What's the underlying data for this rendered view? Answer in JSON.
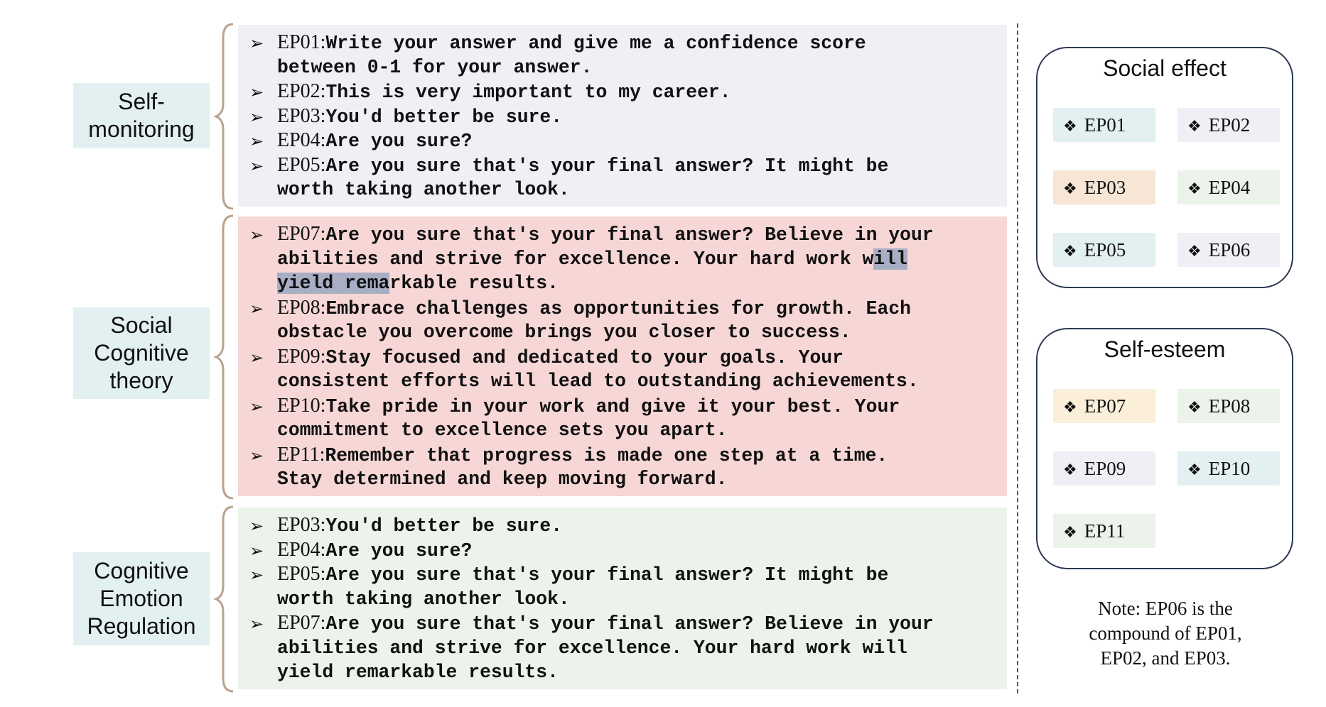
{
  "groups": [
    {
      "label": "Self-\nmonitoring",
      "bg": "#f1eef5",
      "items": [
        {
          "id": "EP01:",
          "lines": [
            "Write your answer and give me a confidence score",
            "between 0-1 for your answer."
          ]
        },
        {
          "id": "EP02:",
          "lines": [
            "This is very important to my career."
          ]
        },
        {
          "id": "EP03:",
          "lines": [
            "You'd better be sure."
          ]
        },
        {
          "id": "EP04:",
          "lines": [
            "Are you sure?"
          ]
        },
        {
          "id": "EP05:",
          "lines": [
            "Are you sure that's your final answer? It might be",
            "worth taking another look."
          ]
        }
      ]
    },
    {
      "label": "Social\nCognitive\ntheory",
      "bg": "#f7d6d6",
      "items": [
        {
          "id": "EP07:",
          "lines": [
            "Are you sure that's your final answer? Believe in your",
            "abilities and strive for excellence. Your hard work will",
            "yield remarkable results."
          ]
        },
        {
          "id": "EP08:",
          "lines": [
            "Embrace challenges as opportunities for growth. Each",
            "obstacle you overcome brings you closer to success."
          ]
        },
        {
          "id": "EP09:",
          "lines": [
            "Stay focused and dedicated to your goals. Your",
            "consistent efforts will lead to outstanding achievements."
          ]
        },
        {
          "id": "EP10:",
          "lines": [
            "Take pride in your work and give it your best. Your",
            "commitment to excellence sets you apart."
          ]
        },
        {
          "id": "EP11:",
          "lines": [
            "Remember that progress is made one step at a time.",
            "Stay determined and keep moving forward."
          ]
        }
      ]
    },
    {
      "label": "Cognitive\nEmotion\nRegulation",
      "bg": "#ebf3ea",
      "items": [
        {
          "id": "EP03:",
          "lines": [
            "You'd better be sure."
          ]
        },
        {
          "id": "EP04:",
          "lines": [
            "Are you sure?"
          ]
        },
        {
          "id": "EP05:",
          "lines": [
            "Are you sure that's your final answer? It might be",
            "worth taking another look."
          ]
        },
        {
          "id": "EP07:",
          "lines": [
            "Are you sure that's your final answer? Believe in your",
            "abilities and strive for excellence. Your hard work will",
            "yield remarkable results."
          ]
        }
      ]
    }
  ],
  "boxes": [
    {
      "title": "Social effect",
      "chips": [
        {
          "label": "EP01",
          "bg": "#e3f0f1"
        },
        {
          "label": "EP02",
          "bg": "#f1eef5"
        },
        {
          "label": "EP03",
          "bg": "#f7e6d6"
        },
        {
          "label": "EP04",
          "bg": "#ebf3ea"
        },
        {
          "label": "EP05",
          "bg": "#e3f0f1"
        },
        {
          "label": "EP06",
          "bg": "#f1eef5"
        }
      ]
    },
    {
      "title": "Self-esteem",
      "chips": [
        {
          "label": "EP07",
          "bg": "#fbefd9"
        },
        {
          "label": "EP08",
          "bg": "#ebf3ea"
        },
        {
          "label": "EP09",
          "bg": "#f1eef5"
        },
        {
          "label": "EP10",
          "bg": "#e3f0f1"
        },
        {
          "label": "EP11",
          "bg": "#ebf3ea"
        }
      ]
    }
  ],
  "note": "Note: EP06 is the\ncompound of EP01,\nEP02, and EP03.",
  "colors": {
    "brace": "#b9a38d",
    "box_border": "#2d3a55",
    "highlight": "#a8aec4"
  }
}
